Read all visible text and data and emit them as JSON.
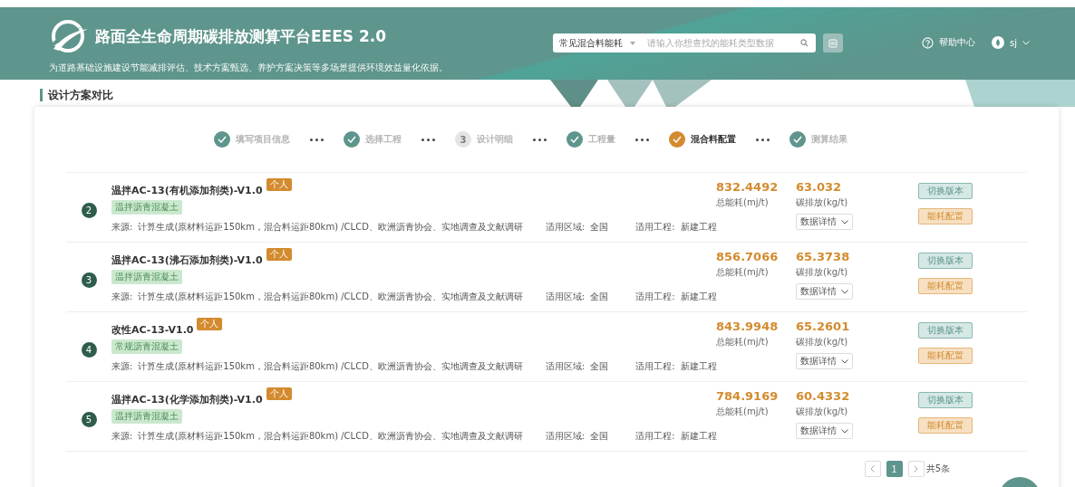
{
  "header": {
    "title": "路面全生命周期碳排放测算平台EEES 2.0",
    "subtitle": "为道路基础设施建设节能减排评估、技术方案甄选、养护方案决策等多场景提供环境效益量化依据。",
    "search": {
      "category": "常见混合料能耗",
      "placeholder": "请输入你想查找的能耗类型数据"
    },
    "help": "帮助中心",
    "user": "sj"
  },
  "page_title": "设计方案对比",
  "steps": [
    {
      "label": "填写项目信息",
      "completed": true,
      "selected": false
    },
    {
      "label": "选择工程",
      "completed": true,
      "selected": false
    },
    {
      "label": "设计明细",
      "completed": false,
      "selected": false,
      "number": "3"
    },
    {
      "label": "工程量",
      "completed": true,
      "selected": false
    },
    {
      "label": "混合料配置",
      "completed": true,
      "selected": true
    },
    {
      "label": "测算结果",
      "completed": true,
      "selected": false
    }
  ],
  "rows": [
    {
      "index": "2",
      "title": "温拌AC-13(有机添加剂类)-V1.0",
      "badge": "个人",
      "tag": "温拌沥青混凝土",
      "source_label": "来源:",
      "source": "计算生成(原材料运距150km，混合料运距80km) /CLCD、欧洲沥青协会、实地调查及文献调研",
      "region_label": "适用区域:",
      "region": "全国",
      "project_label": "适用工程:",
      "project": "新建工程",
      "energy": "832.4492",
      "energy_label": "总能耗(mj/t)",
      "carbon": "63.032",
      "carbon_label": "碳排放(kg/t)",
      "details": "数据详情",
      "switch": "切换版本",
      "config": "能耗配置"
    },
    {
      "index": "3",
      "title": "温拌AC-13(沸石添加剂类)-V1.0",
      "badge": "个人",
      "tag": "温拌沥青混凝土",
      "source_label": "来源:",
      "source": "计算生成(原材料运距150km，混合料运距80km) /CLCD、欧洲沥青协会、实地调查及文献调研",
      "region_label": "适用区域:",
      "region": "全国",
      "project_label": "适用工程:",
      "project": "新建工程",
      "energy": "856.7066",
      "energy_label": "总能耗(mj/t)",
      "carbon": "65.3738",
      "carbon_label": "碳排放(kg/t)",
      "details": "数据详情",
      "switch": "切换版本",
      "config": "能耗配置"
    },
    {
      "index": "4",
      "title": "改性AC-13-V1.0",
      "badge": "个人",
      "tag": "常规沥青混凝土",
      "source_label": "来源:",
      "source": "计算生成(原材料运距150km，混合料运距80km) /CLCD、欧洲沥青协会、实地调查及文献调研",
      "region_label": "适用区域:",
      "region": "全国",
      "project_label": "适用工程:",
      "project": "新建工程",
      "energy": "843.9948",
      "energy_label": "总能耗(mj/t)",
      "carbon": "65.2601",
      "carbon_label": "碳排放(kg/t)",
      "details": "数据详情",
      "switch": "切换版本",
      "config": "能耗配置"
    },
    {
      "index": "5",
      "title": "温拌AC-13(化学添加剂类)-V1.0",
      "badge": "个人",
      "tag": "温拌沥青混凝土",
      "source_label": "来源:",
      "source": "计算生成(原材料运距150km，混合料运距80km) /CLCD、欧洲沥青协会、实地调查及文献调研",
      "region_label": "适用区域:",
      "region": "全国",
      "project_label": "适用工程:",
      "project": "新建工程",
      "energy": "784.9169",
      "energy_label": "总能耗(mj/t)",
      "carbon": "60.4332",
      "carbon_label": "碳排放(kg/t)",
      "details": "数据详情",
      "switch": "切换版本",
      "config": "能耗配置"
    }
  ],
  "pagination": {
    "pages": [
      {
        "label": "1",
        "selected": true
      }
    ],
    "total": "共5条"
  }
}
